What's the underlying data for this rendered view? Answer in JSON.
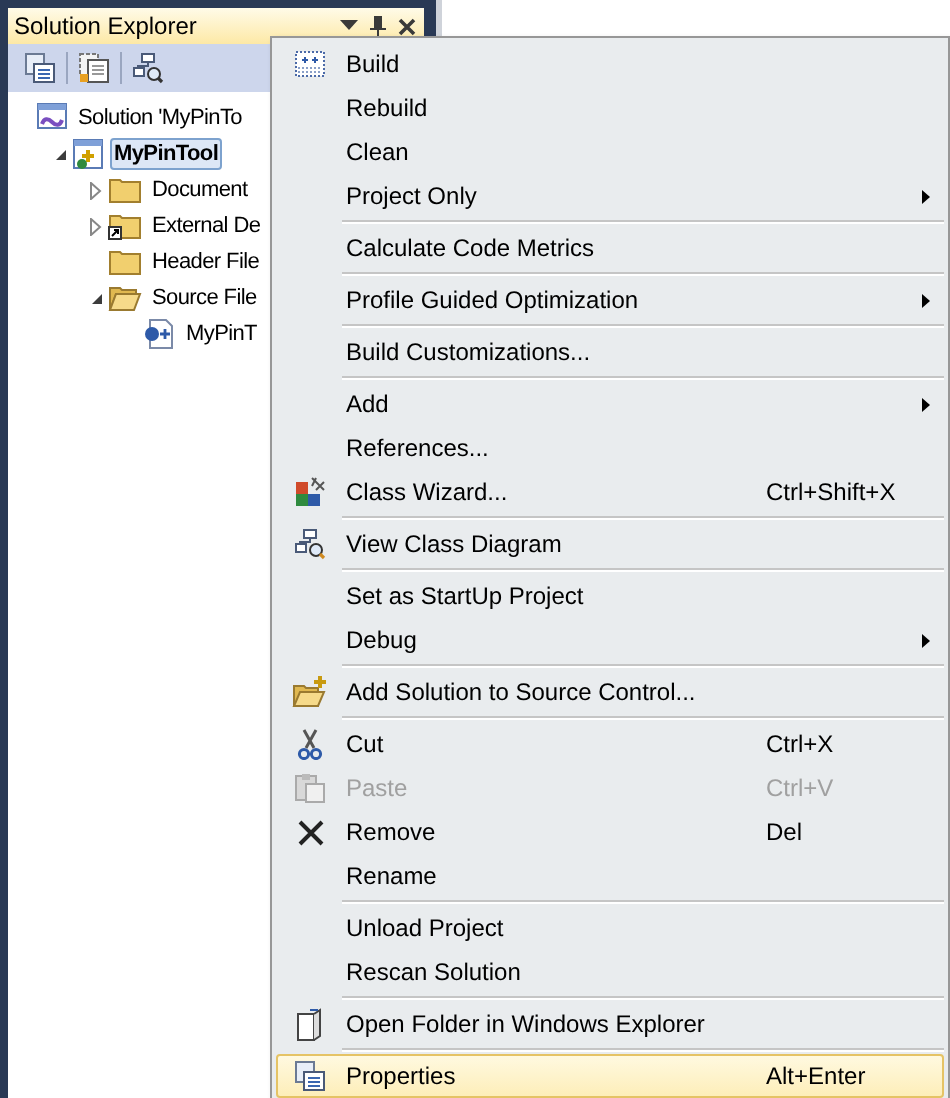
{
  "panel": {
    "title": "Solution Explorer"
  },
  "tree": [
    {
      "kind": "solution",
      "label": "Solution 'MyPinTo",
      "selected": false,
      "children": [
        {
          "kind": "project",
          "label": "MyPinTool",
          "selected": true,
          "expanded": true,
          "children": [
            {
              "kind": "folder",
              "label": "Document",
              "selected": false,
              "expanded": false
            },
            {
              "kind": "external-folder",
              "label": "External De",
              "selected": false,
              "expanded": false
            },
            {
              "kind": "folder",
              "label": "Header File",
              "selected": false
            },
            {
              "kind": "folder",
              "label": "Source File",
              "selected": false,
              "expanded": true,
              "children": [
                {
                  "kind": "cpp-file",
                  "label": "MyPinT",
                  "selected": false
                }
              ]
            }
          ]
        }
      ]
    }
  ],
  "menu": [
    {
      "kind": "item",
      "label": "Build",
      "submenu": false,
      "disabled": false,
      "selected": false
    },
    {
      "kind": "item",
      "label": "Rebuild",
      "submenu": false,
      "disabled": false,
      "selected": false
    },
    {
      "kind": "item",
      "label": "Clean",
      "submenu": false,
      "disabled": false,
      "selected": false
    },
    {
      "kind": "item",
      "label": "Project Only",
      "submenu": true,
      "disabled": false,
      "selected": false
    },
    {
      "kind": "separator"
    },
    {
      "kind": "item",
      "label": "Calculate Code Metrics",
      "submenu": false,
      "disabled": false,
      "selected": false
    },
    {
      "kind": "separator"
    },
    {
      "kind": "item",
      "label": "Profile Guided Optimization",
      "submenu": true,
      "disabled": false,
      "selected": false
    },
    {
      "kind": "separator"
    },
    {
      "kind": "item",
      "label": "Build Customizations...",
      "submenu": false,
      "disabled": false,
      "selected": false
    },
    {
      "kind": "separator"
    },
    {
      "kind": "item",
      "label": "Add",
      "submenu": true,
      "disabled": false,
      "selected": false
    },
    {
      "kind": "item",
      "label": "References...",
      "submenu": false,
      "disabled": false,
      "selected": false
    },
    {
      "kind": "item",
      "label": "Class Wizard...",
      "shortcut": "Ctrl+Shift+X",
      "submenu": false,
      "disabled": false,
      "selected": false
    },
    {
      "kind": "separator"
    },
    {
      "kind": "item",
      "label": "View Class Diagram",
      "submenu": false,
      "disabled": false,
      "selected": false
    },
    {
      "kind": "separator"
    },
    {
      "kind": "item",
      "label": "Set as StartUp Project",
      "submenu": false,
      "disabled": false,
      "selected": false
    },
    {
      "kind": "item",
      "label": "Debug",
      "submenu": true,
      "disabled": false,
      "selected": false
    },
    {
      "kind": "separator"
    },
    {
      "kind": "item",
      "label": "Add Solution to Source Control...",
      "submenu": false,
      "disabled": false,
      "selected": false
    },
    {
      "kind": "separator"
    },
    {
      "kind": "item",
      "label": "Cut",
      "shortcut": "Ctrl+X",
      "submenu": false,
      "disabled": false,
      "selected": false
    },
    {
      "kind": "item",
      "label": "Paste",
      "shortcut": "Ctrl+V",
      "submenu": false,
      "disabled": true,
      "selected": false
    },
    {
      "kind": "item",
      "label": "Remove",
      "shortcut": "Del",
      "submenu": false,
      "disabled": false,
      "selected": false
    },
    {
      "kind": "item",
      "label": "Rename",
      "submenu": false,
      "disabled": false,
      "selected": false
    },
    {
      "kind": "separator"
    },
    {
      "kind": "item",
      "label": "Unload Project",
      "submenu": false,
      "disabled": false,
      "selected": false
    },
    {
      "kind": "item",
      "label": "Rescan Solution",
      "submenu": false,
      "disabled": false,
      "selected": false
    },
    {
      "kind": "separator"
    },
    {
      "kind": "item",
      "label": "Open Folder in Windows Explorer",
      "submenu": false,
      "disabled": false,
      "selected": false
    },
    {
      "kind": "separator"
    },
    {
      "kind": "item",
      "label": "Properties",
      "shortcut": "Alt+Enter",
      "submenu": false,
      "disabled": false,
      "selected": true
    }
  ]
}
